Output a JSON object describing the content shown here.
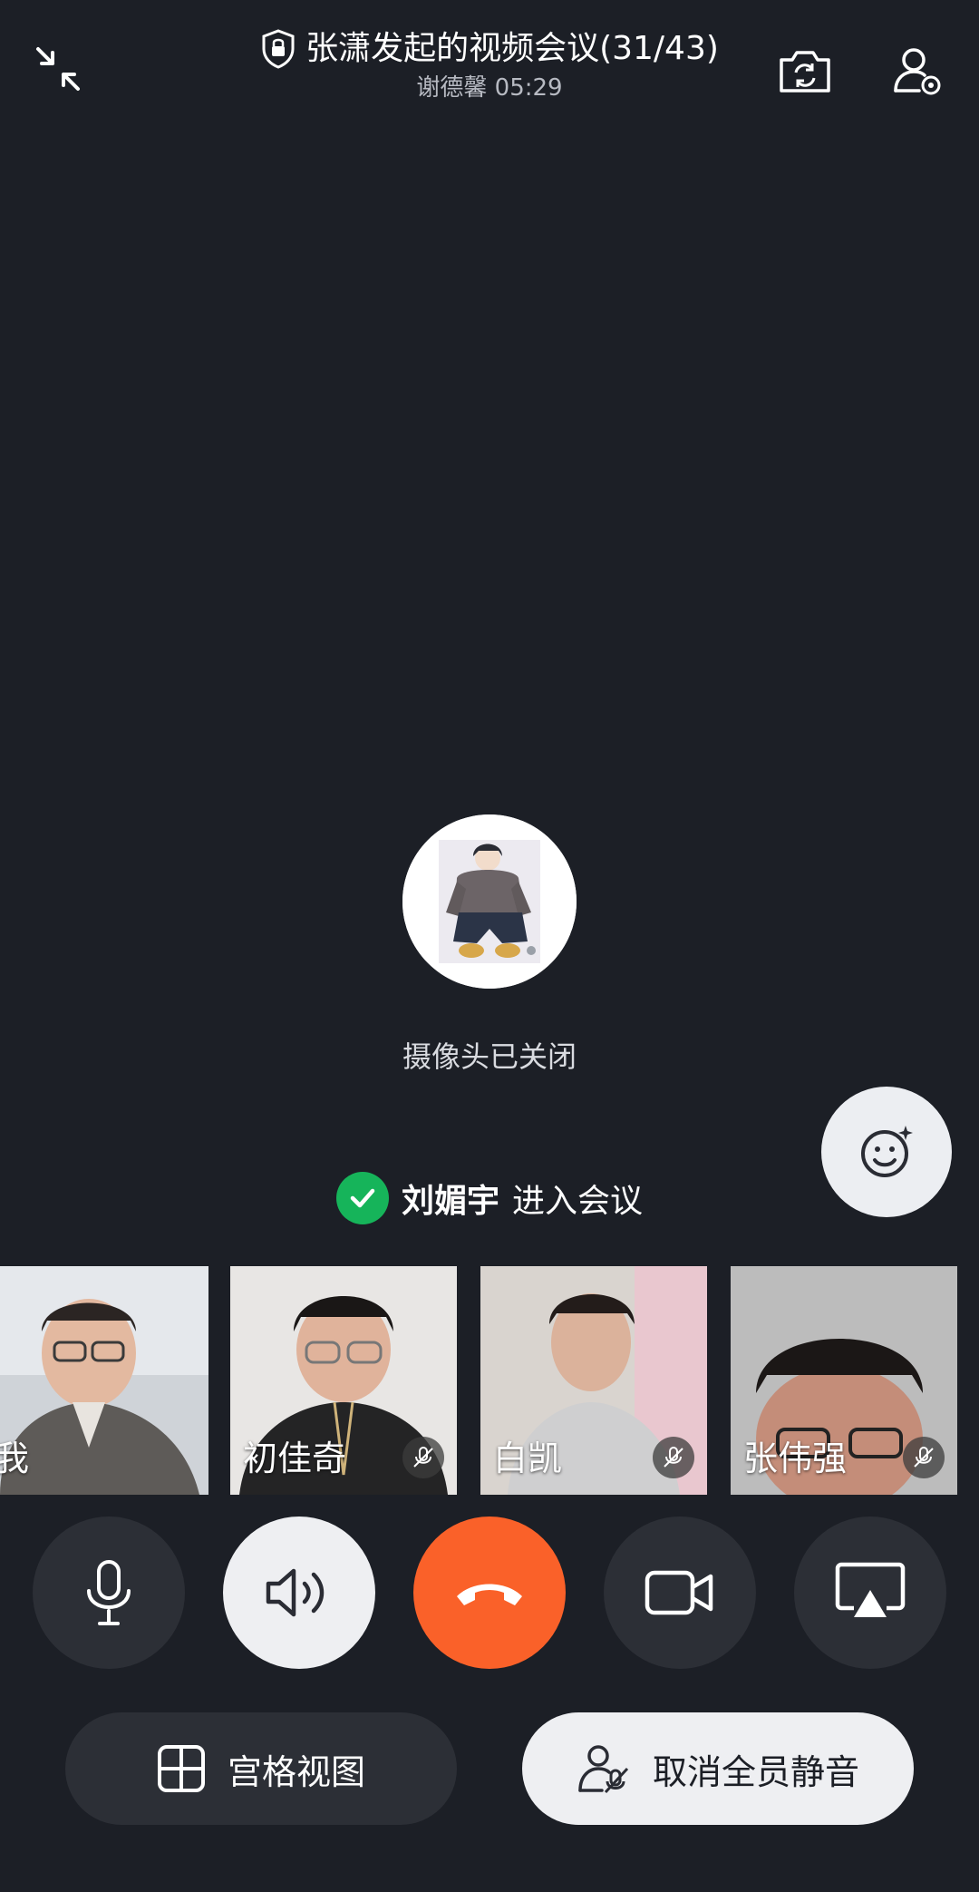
{
  "header": {
    "title": "张潇发起的视频会议(31/43)",
    "subtitle": "谢德馨 05:29"
  },
  "center": {
    "camera_status": "摄像头已关闭"
  },
  "notice": {
    "name": "刘媚宇",
    "action": "进入会议"
  },
  "participants": [
    {
      "name": "我",
      "muted": false
    },
    {
      "name": "初佳奇",
      "muted": true
    },
    {
      "name": "白凯",
      "muted": true
    },
    {
      "name": "张伟强",
      "muted": true
    }
  ],
  "bottom": {
    "grid_label": "宫格视图",
    "unmute_all_label": "取消全员静音"
  },
  "colors": {
    "background": "#1c1f26",
    "hangup": "#fa6129",
    "join_check": "#16b45a"
  },
  "icons": [
    "collapse-icon",
    "lock-icon",
    "camera-switch-icon",
    "member-settings-icon",
    "smiley-sparkle-icon",
    "microphone-icon",
    "speaker-icon",
    "hangup-icon",
    "video-camera-icon",
    "screen-share-icon",
    "grid-icon",
    "unmute-all-icon",
    "mic-muted-icon",
    "check-icon"
  ]
}
